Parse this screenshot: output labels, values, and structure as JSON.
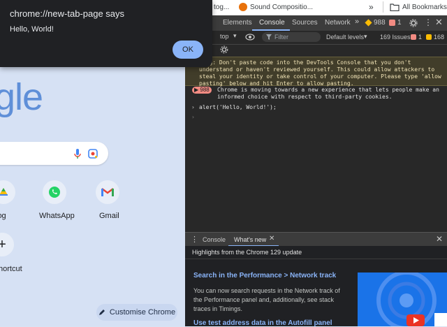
{
  "alert": {
    "title": "chrome://new-tab-page says",
    "message": "Hello, World!",
    "ok_label": "OK"
  },
  "bookmarks_bar": {
    "item1": "tog...",
    "item2": "Sound Compositio...",
    "overflow": "»",
    "all_bookmarks": "All Bookmarks"
  },
  "ntp": {
    "logo_fragment": "gle",
    "shortcuts": [
      {
        "label": "log"
      },
      {
        "label": "WhatsApp"
      },
      {
        "label": "Gmail"
      },
      {
        "label": "hortcut"
      }
    ],
    "customise_label": "Customise Chrome"
  },
  "devtools": {
    "tabs": {
      "elements": "Elements",
      "console": "Console",
      "sources": "Sources",
      "network": "Network",
      "more": "»"
    },
    "counts": {
      "warnings": "988",
      "errors": "1"
    },
    "toolbar": {
      "context": "top",
      "filter_placeholder": "Filter",
      "levels": "Default levels",
      "issues": "169 Issues:",
      "issues_err": "1",
      "issues_warn": "168"
    },
    "console": {
      "warning_lines": [
        "ning: Don't paste code into the DevTools Console that you don't",
        "understand or haven't reviewed yourself. This could allow attackers to",
        "steal your identity or take control of your computer. Please type 'allow",
        "pasting' below and hit Enter to allow pasting."
      ],
      "issue_badge": "988",
      "issue_lines": [
        "Chrome is moving towards a new experience that lets people make an",
        "informed choice with respect to third-party cookies."
      ],
      "command": "alert('Hello, World!');"
    },
    "drawer": {
      "tab_console": "Console",
      "tab_whats_new": "What's new",
      "highlights": "Highlights from the Chrome 129 update",
      "heading1": "Search in the Performance > Network track",
      "para1": [
        "You can now search requests in the Network track of",
        "the Performance panel and, additionally, see stack",
        "traces in Timings."
      ],
      "heading2": "Use test address data in the Autofill panel"
    }
  },
  "colors": {
    "devtools_bg": "#282828",
    "accent": "#8ab4f8",
    "ntp_bg": "#d6e1f4"
  }
}
